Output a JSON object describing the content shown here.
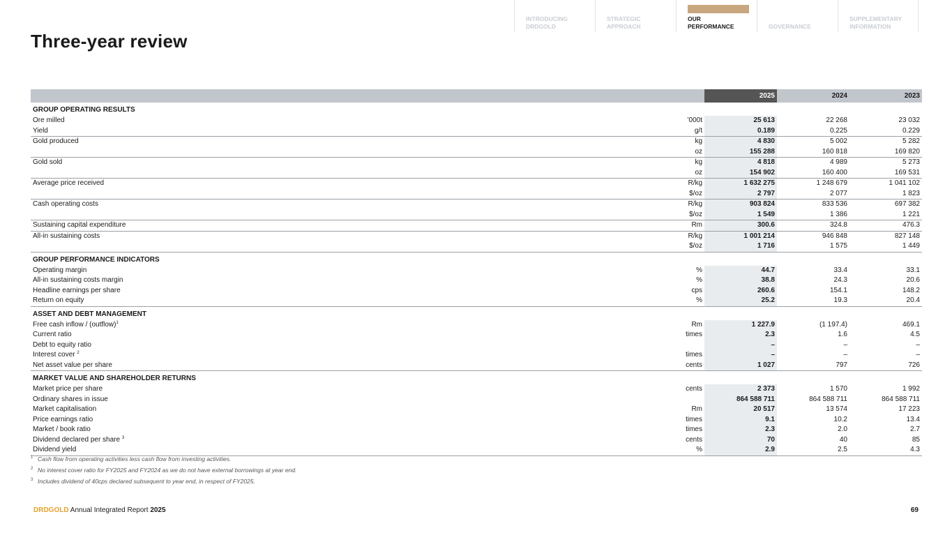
{
  "nav": {
    "items": [
      {
        "label": "INTRODUCING\nDRDGOLD",
        "active": false
      },
      {
        "label": "STRATEGIC\nAPPROACH",
        "active": false
      },
      {
        "label": "OUR\nPERFORMANCE",
        "active": true
      },
      {
        "label": "GOVERNANCE",
        "active": false
      },
      {
        "label": "SUPPLEMENTARY\nINFORMATION",
        "active": false
      }
    ],
    "active_color": "#c8a77f"
  },
  "page_title": "Three-year review",
  "table": {
    "headers": [
      "2025",
      "2024",
      "2023"
    ],
    "rows": [
      {
        "type": "section",
        "label": "GROUP OPERATING RESULTS"
      },
      {
        "label": "Ore milled",
        "unit": "’000t",
        "v": [
          "25 613",
          "22 268",
          "23 032"
        ]
      },
      {
        "label": "Yield",
        "unit": "g/t",
        "v": [
          "0.189",
          "0.225",
          "0.229"
        ],
        "div": true
      },
      {
        "label": "Gold produced",
        "unit": "kg",
        "v": [
          "4 830",
          "5 002",
          "5 282"
        ]
      },
      {
        "label": "",
        "unit": "oz",
        "v": [
          "155 288",
          "160 818",
          "169 820"
        ],
        "div": true
      },
      {
        "label": "Gold sold",
        "unit": "kg",
        "v": [
          "4 818",
          "4 989",
          "5 273"
        ]
      },
      {
        "label": "",
        "unit": "oz",
        "v": [
          "154 902",
          "160 400",
          "169 531"
        ],
        "div": true
      },
      {
        "label": "Average price received",
        "unit": "R/kg",
        "v": [
          "1 632 275",
          "1 248 679",
          "1 041 102"
        ]
      },
      {
        "label": "",
        "unit": "$/oz",
        "v": [
          "2 797",
          "2 077",
          "1 823"
        ],
        "div": true
      },
      {
        "label": "Cash operating costs",
        "unit": "R/kg",
        "v": [
          "903 824",
          "833 536",
          "697 382"
        ]
      },
      {
        "label": "",
        "unit": "$/oz",
        "v": [
          "1 549",
          "1 386",
          "1 221"
        ],
        "div": true
      },
      {
        "label": "Sustaining capital expenditure",
        "unit": "Rm",
        "v": [
          "300.6",
          "324.8",
          "476.3"
        ],
        "div": true
      },
      {
        "label": "All-in sustaining costs",
        "unit": "R/kg",
        "v": [
          "1 001 214",
          "946 848",
          "827 148"
        ]
      },
      {
        "label": "",
        "unit": "$/oz",
        "v": [
          "1 716",
          "1 575",
          "1 449"
        ],
        "div": true
      },
      {
        "type": "section",
        "label": "GROUP PERFORMANCE INDICATORS"
      },
      {
        "label": "Operating margin",
        "unit": "%",
        "v": [
          "44.7",
          "33.4",
          "33.1"
        ]
      },
      {
        "label": "All-in sustaining costs margin",
        "unit": "%",
        "v": [
          "38.8",
          "24.3",
          "20.6"
        ]
      },
      {
        "label": "Headline earnings per share",
        "unit": "cps",
        "v": [
          "260.6",
          "154.1",
          "148.2"
        ]
      },
      {
        "label": "Return on equity",
        "unit": "%",
        "v": [
          "25.2",
          "19.3",
          "20.4"
        ],
        "div": true
      },
      {
        "type": "section",
        "label": "ASSET AND DEBT MANAGEMENT"
      },
      {
        "label": "Free cash inflow / (outflow)",
        "sup": "1",
        "unit": "Rm",
        "v": [
          "1 227.9",
          "(1 197.4)",
          "469.1"
        ]
      },
      {
        "label": "Current ratio",
        "unit": "times",
        "v": [
          "2.3",
          "1.6",
          "4.5"
        ]
      },
      {
        "label": "Debt to equity ratio",
        "unit": "",
        "v": [
          "–",
          "–",
          "–"
        ]
      },
      {
        "label": "Interest cover ",
        "sup": "2",
        "unit": "times",
        "v": [
          "–",
          "–",
          "–"
        ]
      },
      {
        "label": "Net asset value per share",
        "unit": "cents",
        "v": [
          "1 027",
          "797",
          "726"
        ],
        "div": true
      },
      {
        "type": "section",
        "label": "MARKET VALUE AND SHAREHOLDER RETURNS"
      },
      {
        "label": "Market price per share",
        "unit": "cents",
        "v": [
          "2 373",
          "1 570",
          "1 992"
        ]
      },
      {
        "label": "Ordinary shares in issue",
        "unit": "",
        "v": [
          "864 588 711",
          "864 588 711",
          "864 588 711"
        ]
      },
      {
        "label": "Market capitalisation",
        "unit": "Rm",
        "v": [
          "20 517",
          "13 574",
          "17 223"
        ]
      },
      {
        "label": "Price earnings ratio",
        "unit": "times",
        "v": [
          "9.1",
          "10.2",
          "13.4"
        ]
      },
      {
        "label": "Market / book ratio",
        "unit": "times",
        "v": [
          "2.3",
          "2.0",
          "2.7"
        ]
      },
      {
        "label": "Dividend declared per share ",
        "sup": "3",
        "unit": "cents",
        "v": [
          "70",
          "40",
          "85"
        ]
      },
      {
        "label": "Dividend yield",
        "unit": "%",
        "v": [
          "2.9",
          "2.5",
          "4.3"
        ],
        "div": true
      }
    ]
  },
  "footnotes": [
    {
      "num": "1",
      "text": "Cash flow from operating activities less cash flow from investing activities."
    },
    {
      "num": "2",
      "text": "No interest cover ratio for FY2025 and FY2024 as we do not have external borrowings at year end."
    },
    {
      "num": "3",
      "text": "Includes dividend of 40cps declared subsequent to year end, in respect of FY2025."
    }
  ],
  "footer": {
    "brand": "DRDGOLD",
    "report": " Annual Integrated Report ",
    "year": "2025",
    "page_number": "69",
    "brand_color": "#e6a22f"
  }
}
